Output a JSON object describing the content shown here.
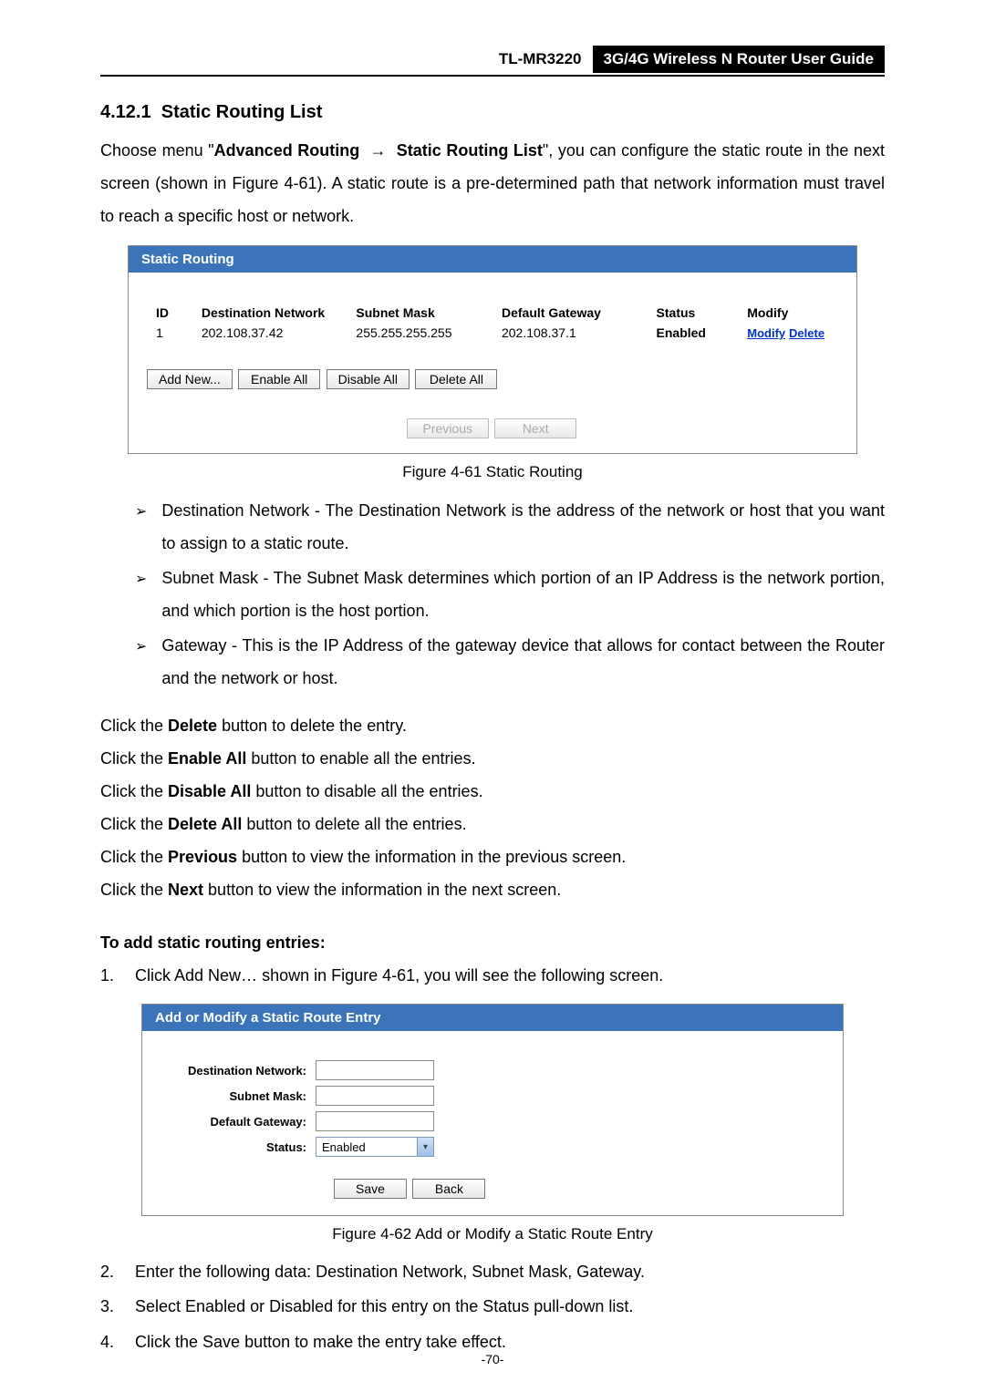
{
  "header": {
    "model": "TL-MR3220",
    "title": "3G/4G Wireless N Router User Guide"
  },
  "section": {
    "number": "4.12.1",
    "title": "Static Routing List"
  },
  "intro": {
    "part1": "Choose menu \"",
    "menu1": "Advanced Routing",
    "arrow": "→",
    "menu2": "Static Routing List",
    "part2": "\", you can configure the static route in the next screen (shown in Figure 4-61). A static route is a pre-determined path that network information must travel to reach a specific host or network."
  },
  "screenshot1": {
    "title": "Static Routing",
    "columns": {
      "id": "ID",
      "dest": "Destination Network",
      "mask": "Subnet Mask",
      "gw": "Default Gateway",
      "status": "Status",
      "modify": "Modify"
    },
    "row": {
      "id": "1",
      "dest": "202.108.37.42",
      "mask": "255.255.255.255",
      "gw": "202.108.37.1",
      "status": "Enabled",
      "modify_link": "Modify",
      "delete_link": "Delete"
    },
    "buttons": {
      "add_new": "Add New...",
      "enable_all": "Enable All",
      "disable_all": "Disable All",
      "delete_all": "Delete All",
      "previous": "Previous",
      "next": "Next"
    }
  },
  "caption1": "Figure 4-61    Static Routing",
  "bullets": {
    "b1_label": "Destination Network -",
    "b1_text1": " The ",
    "b1_bold": "Destination Network",
    "b1_text2": " is the address of the network or host that you want to assign to a static route.",
    "b2_label": "Subnet Mask -",
    "b2_text1": " The ",
    "b2_bold": "Subnet Mask",
    "b2_text2": " determines which portion of an IP Address is the network portion, and which portion is the host portion.",
    "b3_label": "Gateway -",
    "b3_text": " This is the IP Address of the gateway device that allows for contact between the Router and the network or host."
  },
  "clicks": {
    "c1_pre": "Click the ",
    "c1_bold": "Delete",
    "c1_post": " button to delete the entry.",
    "c2_pre": "Click the ",
    "c2_bold": "Enable All",
    "c2_post": " button to enable all the entries.",
    "c3_pre": "Click the ",
    "c3_bold": "Disable All",
    "c3_post": " button to disable all the entries.",
    "c4_pre": "Click the ",
    "c4_bold": "Delete All",
    "c4_post": " button to delete all the entries.",
    "c5_pre": "Click the ",
    "c5_bold": "Previous",
    "c5_post": " button to view the information in the previous screen.",
    "c6_pre": "Click the ",
    "c6_bold": "Next",
    "c6_post": " button to view the information in the next screen."
  },
  "subhead": "To add static routing entries:",
  "numbered": {
    "n1_pre": "Click ",
    "n1_bold": "Add New…",
    "n1_post": " shown in Figure 4-61, you will see the following screen.",
    "n2": "Enter the following data: Destination Network, Subnet Mask, Gateway.",
    "n3_pre": "Select ",
    "n3_b1": "Enabled",
    "n3_mid": " or ",
    "n3_b2": "Disabled",
    "n3_mid2": " for this entry on the ",
    "n3_b3": "Status",
    "n3_post": " pull-down list.",
    "n4_pre": "Click the ",
    "n4_bold": "Save",
    "n4_post": " button to make the entry take effect."
  },
  "screenshot2": {
    "title": "Add or Modify a Static Route Entry",
    "labels": {
      "dest": "Destination Network:",
      "mask": "Subnet Mask:",
      "gw": "Default Gateway:",
      "status": "Status:"
    },
    "status_value": "Enabled",
    "buttons": {
      "save": "Save",
      "back": "Back"
    }
  },
  "caption2": "Figure 4-62    Add or Modify a Static Route Entry",
  "page_number": "-70-"
}
